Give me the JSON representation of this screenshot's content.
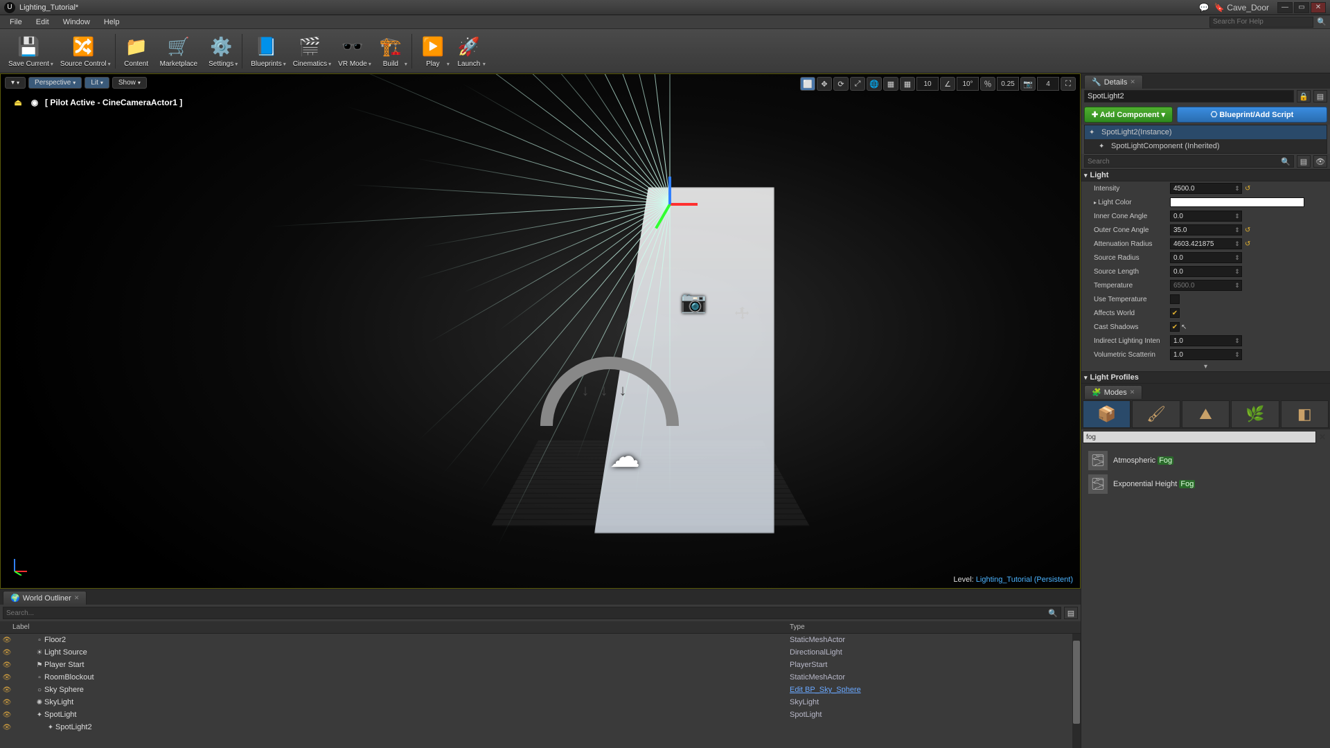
{
  "titlebar": {
    "document": "Lighting_Tutorial*",
    "project": "Cave_Door"
  },
  "menu": {
    "items": [
      "File",
      "Edit",
      "Window",
      "Help"
    ],
    "search_placeholder": "Search For Help"
  },
  "toolbar": {
    "save": "Save Current",
    "source": "Source Control",
    "content": "Content",
    "marketplace": "Marketplace",
    "settings": "Settings",
    "blueprints": "Blueprints",
    "cinematics": "Cinematics",
    "vrmode": "VR Mode",
    "build": "Build",
    "play": "Play",
    "launch": "Launch"
  },
  "viewport": {
    "perspective": "Perspective",
    "lit": "Lit",
    "show": "Show",
    "pilot": "[ Pilot Active - CineCameraActor1 ]",
    "level_label": "Level:",
    "level_name": "Lighting_Tutorial (Persistent)",
    "snap_pos": "10",
    "snap_rot": "10°",
    "snap_scale": "0.25",
    "cam_speed": "4"
  },
  "outliner": {
    "title": "World Outliner",
    "search_placeholder": "Search...",
    "col_label": "Label",
    "col_type": "Type",
    "rows": [
      {
        "indent": 2,
        "icon": "▫",
        "label": "Floor2",
        "type": "StaticMeshActor"
      },
      {
        "indent": 2,
        "icon": "☀",
        "label": "Light Source",
        "type": "DirectionalLight"
      },
      {
        "indent": 2,
        "icon": "⚑",
        "label": "Player Start",
        "type": "PlayerStart"
      },
      {
        "indent": 2,
        "icon": "▫",
        "label": "RoomBlockout",
        "type": "StaticMeshActor"
      },
      {
        "indent": 2,
        "icon": "○",
        "label": "Sky Sphere",
        "type": "Edit BP_Sky_Sphere",
        "link": true
      },
      {
        "indent": 2,
        "icon": "✺",
        "label": "SkyLight",
        "type": "SkyLight"
      },
      {
        "indent": 2,
        "icon": "✦",
        "label": "SpotLight",
        "type": "SpotLight"
      },
      {
        "indent": 3,
        "icon": "✦",
        "label": "SpotLight2",
        "type": ""
      }
    ]
  },
  "details": {
    "title": "Details",
    "actor_name": "SpotLight2",
    "add_component": "Add Component",
    "blueprint_btn": "Blueprint/Add Script",
    "components": [
      {
        "label": "SpotLight2(Instance)",
        "sel": true
      },
      {
        "label": "SpotLightComponent (Inherited)",
        "sel": false
      }
    ],
    "search_placeholder": "Search",
    "cat_light": "Light",
    "props": {
      "intensity": {
        "label": "Intensity",
        "value": "4500.0",
        "reset": true
      },
      "lightcolor": {
        "label": "Light Color"
      },
      "innercone": {
        "label": "Inner Cone Angle",
        "value": "0.0"
      },
      "outercone": {
        "label": "Outer Cone Angle",
        "value": "35.0",
        "reset": true
      },
      "atten": {
        "label": "Attenuation Radius",
        "value": "4603.421875",
        "reset": true
      },
      "srcradius": {
        "label": "Source Radius",
        "value": "0.0"
      },
      "srclen": {
        "label": "Source Length",
        "value": "0.0"
      },
      "temp": {
        "label": "Temperature",
        "value": "6500.0",
        "disabled": true
      },
      "usetemp": {
        "label": "Use Temperature",
        "checked": false
      },
      "affects": {
        "label": "Affects World",
        "checked": true
      },
      "shadows": {
        "label": "Cast Shadows",
        "checked": true
      },
      "indirect": {
        "label": "Indirect Lighting Inten",
        "value": "1.0"
      },
      "volscat": {
        "label": "Volumetric Scatterin",
        "value": "1.0"
      }
    },
    "cat_profiles": "Light Profiles"
  },
  "modes": {
    "title": "Modes",
    "search_value": "fog",
    "items": [
      {
        "pre": "Atmospheric ",
        "hl": "Fog"
      },
      {
        "pre": "Exponential Height ",
        "hl": "Fog"
      }
    ]
  }
}
